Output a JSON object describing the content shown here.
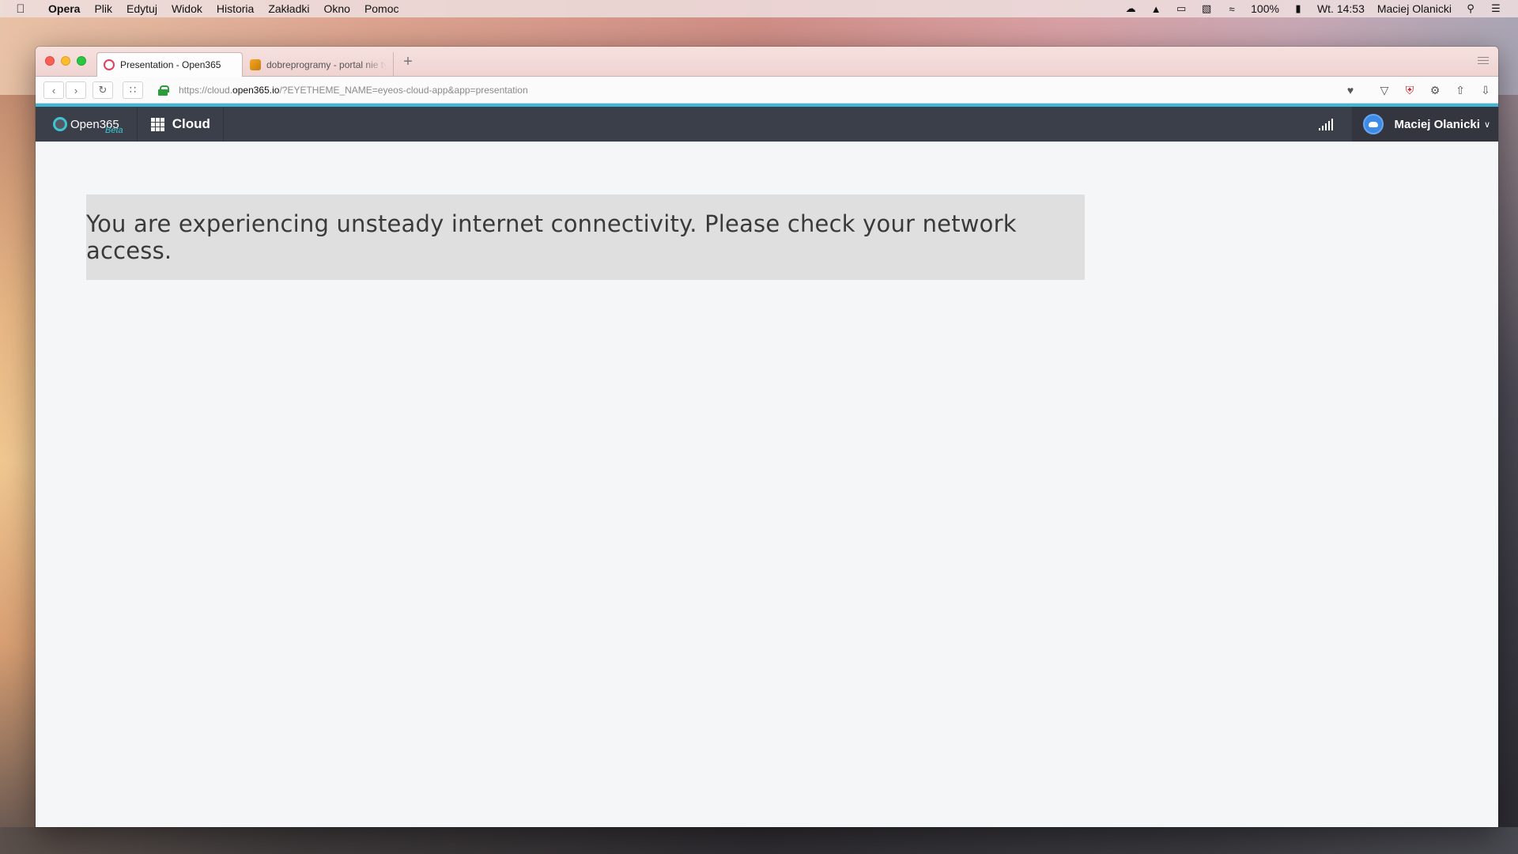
{
  "menubar": {
    "app_name": "Opera",
    "items": [
      "Plik",
      "Edytuj",
      "Widok",
      "Historia",
      "Zakładki",
      "Okno",
      "Pomoc"
    ],
    "battery": "100%",
    "clock": "Wt. 14:53",
    "user": "Maciej Olanicki"
  },
  "browser": {
    "tabs": [
      {
        "label": "Presentation - Open365",
        "active": true
      },
      {
        "label": "dobreprogramy - portal nie tylko o programach",
        "active": false
      }
    ],
    "new_tab": "+",
    "url": {
      "scheme": "https://cloud.",
      "host": "open365.io",
      "path": "/?EYETHEME_NAME=eyeos-cloud-app&app=presentation"
    }
  },
  "app": {
    "logo_text": "Open365",
    "logo_badge": "Beta",
    "app_name": "Cloud",
    "user_name": "Maciej Olanicki"
  },
  "alert": {
    "message": "You are experiencing unsteady internet connectivity. Please check your network access."
  },
  "colors": {
    "header_bg": "#3b3f4a",
    "accent": "#3fb8d8",
    "alert_bg": "#dfdfdf",
    "content_bg": "#f5f6f8"
  }
}
